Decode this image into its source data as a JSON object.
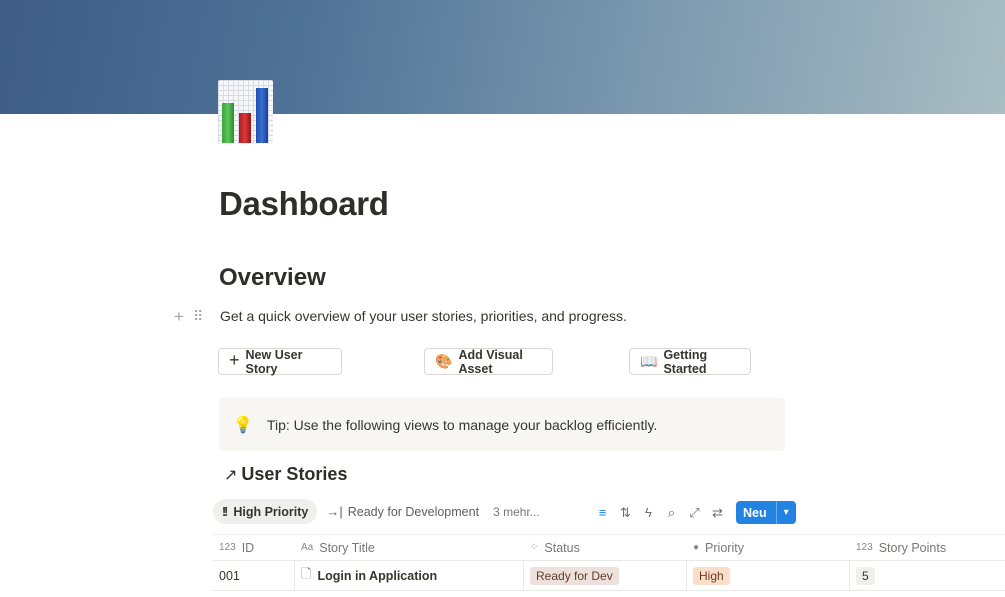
{
  "page": {
    "title": "Dashboard",
    "section_heading": "Overview",
    "description": "Get a quick overview of your user stories, priorities, and progress.",
    "block_handles": {
      "plus": "+",
      "drag": "⠿"
    }
  },
  "colors": {
    "cover_gradient": [
      "#3e5c86",
      "#4f7296",
      "#7896ad",
      "#a9bdc3"
    ],
    "accent_blue": "#2383e2",
    "status_pill": "#eee0da",
    "priority_pill": "#fadec9",
    "callout_bg": "#f7f6f3"
  },
  "buttons": [
    {
      "icon": "plus-icon",
      "glyph": "+",
      "label": "New User Story"
    },
    {
      "icon": "palette-icon",
      "glyph": "🎨",
      "label": "Add Visual Asset"
    },
    {
      "icon": "book-icon",
      "glyph": "📖",
      "label": "Getting Started"
    }
  ],
  "callout": {
    "icon": "lightbulb-icon",
    "glyph": "💡",
    "text": "Tip: Use the following views to manage your backlog efficiently."
  },
  "database": {
    "arrow": "↗",
    "title": "User Stories",
    "views": [
      {
        "icon": "double-exclamation-icon",
        "glyph": "!!",
        "label": "High Priority",
        "active": true
      },
      {
        "icon": "arrow-right-to-bar-icon",
        "glyph": "→|",
        "label": "Ready for Development",
        "active": false
      }
    ],
    "more_views": "3 mehr...",
    "toolbar": {
      "filter": "≡",
      "sort": "⇅",
      "automation": "ϟ",
      "search": "⌕",
      "expand": "⤢",
      "settings": "⇄",
      "new_label": "Neu",
      "new_chevron": "▾"
    },
    "columns": [
      {
        "icon": "number-icon",
        "glyph": "123",
        "label": "ID"
      },
      {
        "icon": "text-icon",
        "glyph": "Aa",
        "label": "Story Title"
      },
      {
        "icon": "status-icon",
        "glyph": "⁘",
        "label": "Status"
      },
      {
        "icon": "priority-icon",
        "glyph": "●",
        "label": "Priority"
      },
      {
        "icon": "number-icon",
        "glyph": "123",
        "label": "Story Points"
      }
    ],
    "rows": [
      {
        "id": "001",
        "doc_glyph": "🗋",
        "title": "Login in Application",
        "status": "Ready for Dev",
        "priority": "High",
        "points": "5"
      }
    ]
  }
}
